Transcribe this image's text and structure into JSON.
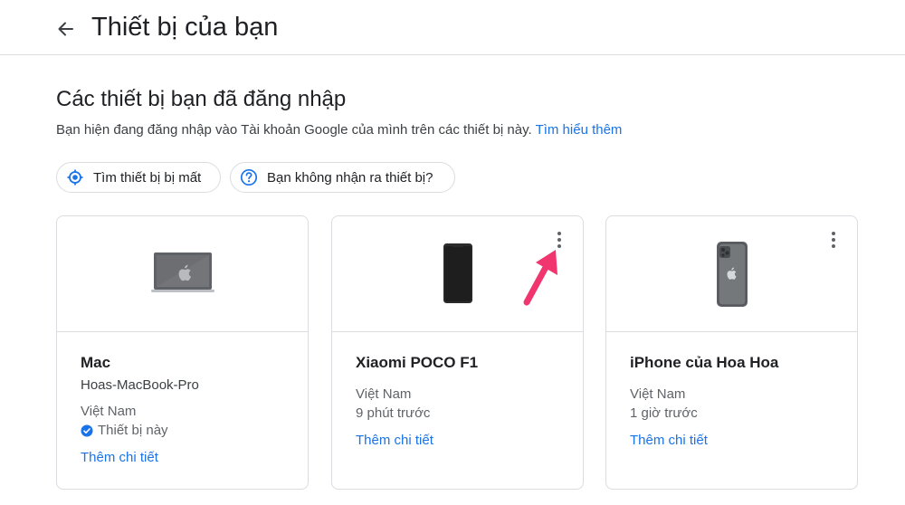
{
  "header": {
    "title": "Thiết bị của bạn"
  },
  "section": {
    "title": "Các thiết bị bạn đã đăng nhập",
    "description": "Bạn hiện đang đăng nhập vào Tài khoản Google của mình trên các thiết bị này.",
    "learn_more": "Tìm hiểu thêm"
  },
  "chips": {
    "find_device": "Tìm thiết bị bị mất",
    "unrecognized": "Bạn không nhận ra thiết bị?"
  },
  "devices": [
    {
      "name": "Mac",
      "host": "Hoas-MacBook-Pro",
      "location": "Việt Nam",
      "status": "Thiết bị này",
      "more": "Thêm chi tiết",
      "icon": "laptop-icon"
    },
    {
      "name": "Xiaomi POCO F1",
      "location": "Việt Nam",
      "last_seen": "9 phút trước",
      "more": "Thêm chi tiết",
      "icon": "android-phone-icon"
    },
    {
      "name": "iPhone của Hoa Hoa",
      "location": "Việt Nam",
      "last_seen": "1 giờ trước",
      "more": "Thêm chi tiết",
      "icon": "iphone-icon"
    }
  ],
  "colors": {
    "accent": "#1a73e8",
    "annotation_arrow": "#f0356f",
    "border": "#dadce0"
  }
}
